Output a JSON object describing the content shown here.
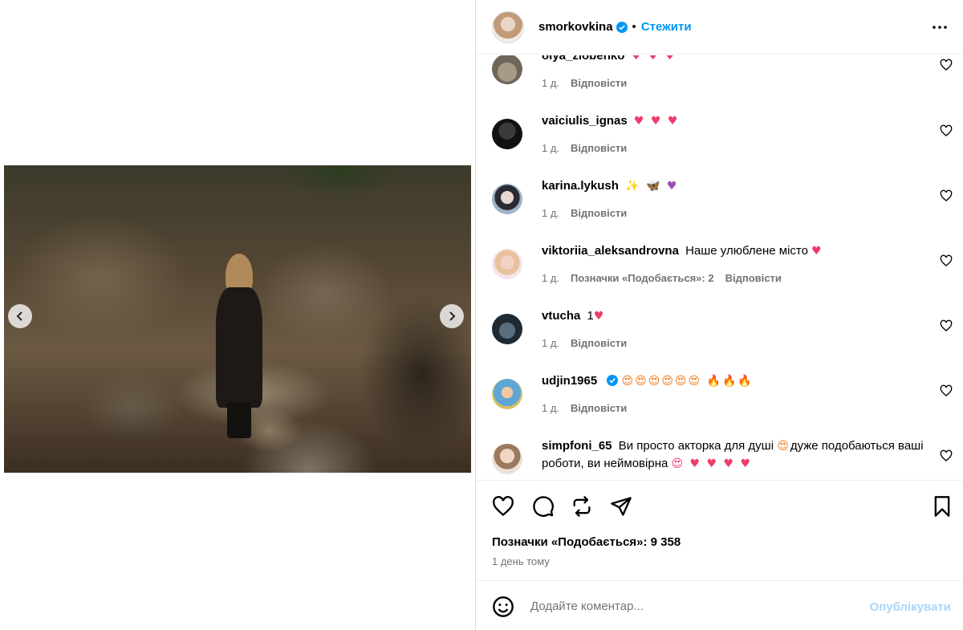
{
  "post": {
    "username": "smorkovkina",
    "follow_label": "Стежити",
    "dot": "•",
    "likes_text": "Позначки «Подобається»: 9 358",
    "time_text": "1 день тому"
  },
  "comments": [
    {
      "user": "olya_zlobenko",
      "text": "",
      "emoji": "♥ ♥ ♥",
      "age": "1 д.",
      "likes": "",
      "reply": "Відповісти"
    },
    {
      "user": "vaiciulis_ignas",
      "text": "",
      "emoji": "♥ ♥ ♥",
      "age": "1 д.",
      "likes": "",
      "reply": "Відповісти"
    },
    {
      "user": "karina.lykush",
      "text": "",
      "emoji": "✨ 🦋 ♥",
      "age": "1 д.",
      "likes": "",
      "reply": "Відповісти"
    },
    {
      "user": "viktoriia_aleksandrovna",
      "text": "Наше улюблене місто",
      "emoji": "♥",
      "age": "1 д.",
      "likes": "Позначки «Подобається»: 2",
      "reply": "Відповісти"
    },
    {
      "user": "vtucha",
      "text": "1",
      "emoji": "♥",
      "age": "1 д.",
      "likes": "",
      "reply": "Відповісти"
    },
    {
      "user": "udjin1965",
      "text": "",
      "emoji": "😍😍😍😍😍😍 🔥🔥🔥",
      "age": "1 д.",
      "likes": "",
      "reply": "Відповісти"
    },
    {
      "user": "simpfoni_65",
      "text": "Ви просто акторка для душі",
      "emoji": "😍",
      "text2": "дуже подобаються ваші роботи, ви неймовірна",
      "emoji2": "😍 ♥ ♥ ♥ ♥"
    }
  ],
  "composer": {
    "placeholder": "Додайте коментар...",
    "post_label": "Опублікувати"
  },
  "icons": {
    "verified": "verified-badge-icon",
    "more": "more-options-icon",
    "like": "heart-icon",
    "comment": "comment-icon",
    "repost": "repost-icon",
    "share": "share-icon",
    "save": "bookmark-icon",
    "emoji": "smile-icon"
  },
  "colors": {
    "link": "#0095f6",
    "muted": "#737373",
    "post_disabled": "#a8d7fb",
    "heart": "#ef3d6b"
  }
}
